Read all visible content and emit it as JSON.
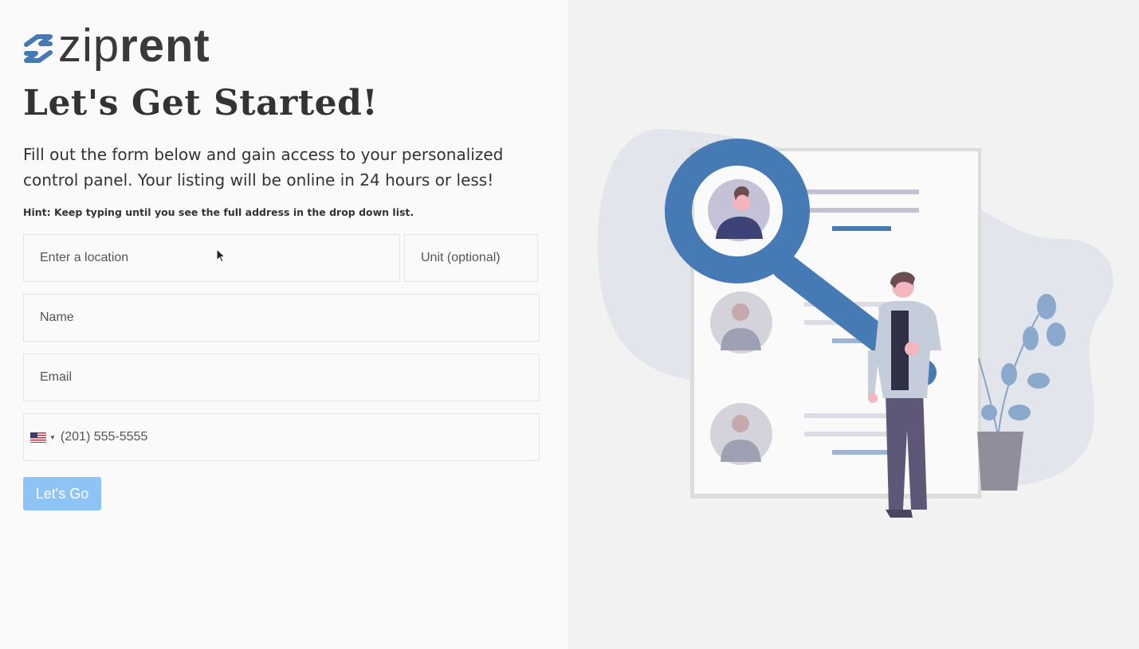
{
  "brand": {
    "zip": "zip",
    "rent": "rent",
    "icon": "ziprent-logo-icon"
  },
  "page": {
    "title": "Let's Get Started!",
    "intro": "Fill out the form below and gain access to your personalized control panel. Your listing will be online in 24 hours or less!",
    "hint": "Hint: Keep typing until you see the full address in the drop down list."
  },
  "form": {
    "location_placeholder": "Enter a location",
    "unit_placeholder": "Unit (optional)",
    "name_placeholder": "Name",
    "email_placeholder": "Email",
    "phone_placeholder": "(201) 555-5555",
    "phone_country_icon": "us-flag-icon",
    "submit_label": "Let's Go"
  },
  "colors": {
    "accent": "#467ab5",
    "button": "#8ec3f6",
    "heading": "#333333",
    "illustration_bg": "#e3e5ec"
  }
}
